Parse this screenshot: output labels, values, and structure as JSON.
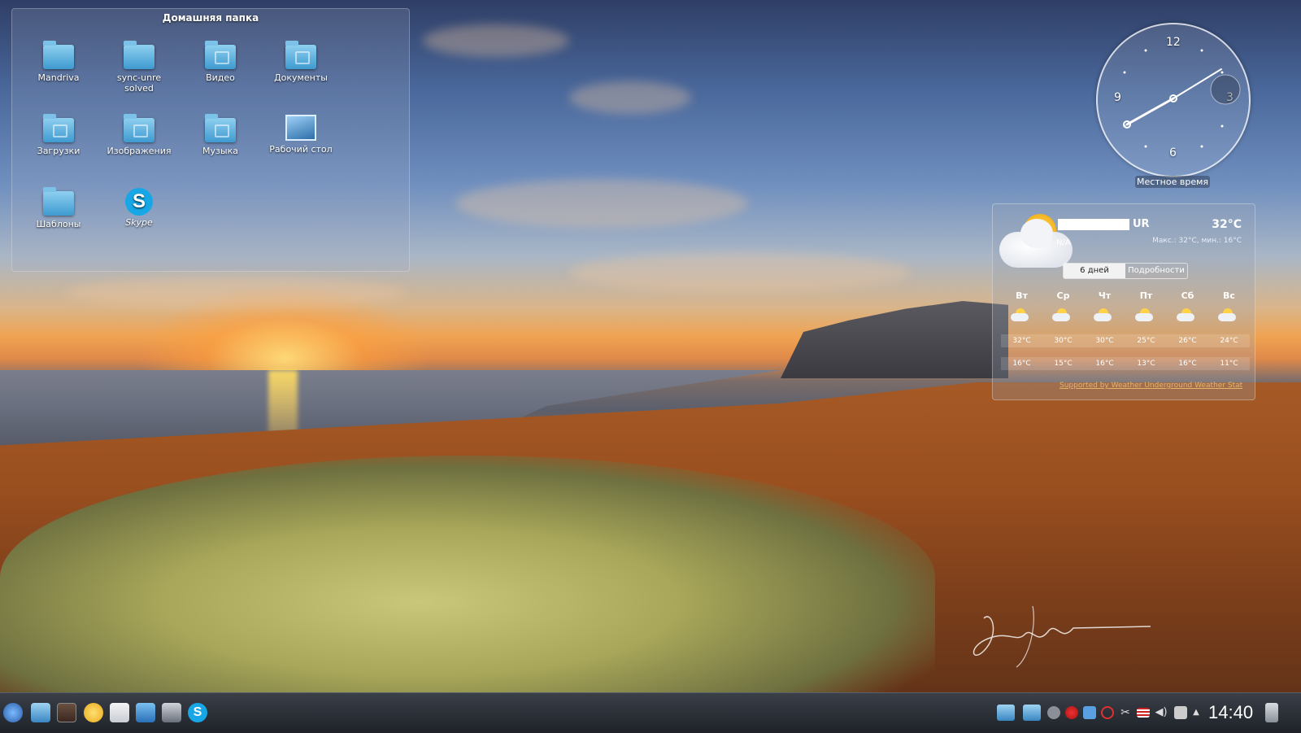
{
  "folder_view": {
    "title": "Домашняя папка",
    "items": [
      {
        "label": "Mandriva",
        "icon": "folder-icon"
      },
      {
        "label": "sync-unresolved",
        "icon": "folder-icon"
      },
      {
        "label": "Видео",
        "icon": "folder-video-icon"
      },
      {
        "label": "Документы",
        "icon": "folder-documents-icon"
      },
      {
        "label": "Загрузки",
        "icon": "folder-downloads-icon"
      },
      {
        "label": "Изображения",
        "icon": "folder-pictures-icon"
      },
      {
        "label": "Музыка",
        "icon": "folder-music-icon"
      },
      {
        "label": "Рабочий стол",
        "icon": "desktop-icon"
      },
      {
        "label": "Шаблоны",
        "icon": "folder-templates-icon"
      },
      {
        "label": "Skype",
        "icon": "skype-icon"
      }
    ]
  },
  "clock_widget": {
    "numbers": {
      "n12": "12",
      "n3": "3",
      "n6": "6",
      "n9": "9"
    },
    "label": "Местное время",
    "time": "14:40"
  },
  "weather": {
    "location_suffix": "UR",
    "temperature": "32°C",
    "range": "Макс.: 32°C, мин.: 16°C",
    "condition_na": "N/A",
    "tabs": [
      "6 дней",
      "Подробности"
    ],
    "days": [
      "Вт",
      "Ср",
      "Чт",
      "Пт",
      "Сб",
      "Вс"
    ],
    "highs": [
      "32°C",
      "30°C",
      "30°C",
      "25°C",
      "26°C",
      "24°C"
    ],
    "lows": [
      "16°C",
      "15°C",
      "16°C",
      "13°C",
      "16°C",
      "11°C"
    ],
    "source_link": "Supported by Weather Underground Weather Stat"
  },
  "taskbar": {
    "clock": "14:40",
    "launchers": [
      "kickoff-menu-icon",
      "file-manager-icon",
      "terminal-icon",
      "messenger-icon",
      "mail-icon",
      "media-player-icon",
      "screenshot-icon",
      "skype-icon"
    ],
    "tray": [
      "folder-icon",
      "folder-icon",
      "info-icon",
      "network-icon",
      "updates-icon",
      "clipboard-icon",
      "scissors-icon",
      "us-flag-icon",
      "volume-icon",
      "notification-icon",
      "expand-arrow-icon",
      "trash-icon"
    ]
  },
  "colors": {
    "accent": "#17a7e6",
    "taskbar": "#1e2228",
    "link": "#e4b36a"
  }
}
